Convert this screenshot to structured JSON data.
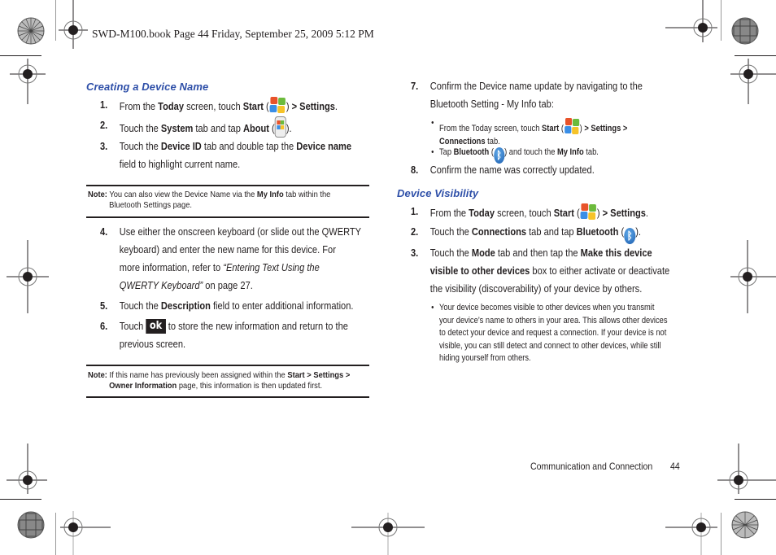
{
  "header": {
    "print_line": "SWD-M100.book  Page 44  Friday, September 25, 2009  5:12 PM"
  },
  "icons": {
    "start": "windows-start-icon",
    "about": "about-device-icon",
    "bluetooth": "bluetooth-icon",
    "ok": "ok"
  },
  "left_column": {
    "section_title": "Creating a Device Name",
    "steps": [
      {
        "num": "1.",
        "parts": [
          "From the ",
          "Today",
          " screen, touch ",
          "Start",
          " (",
          ") ",
          "> Settings",
          "."
        ]
      },
      {
        "num": "2.",
        "parts": [
          "Touch the ",
          "System",
          " tab and tap ",
          "About",
          " (",
          ")."
        ]
      },
      {
        "num": "3.",
        "line1": [
          "Touch the ",
          "Device ID",
          " tab and double tap the ",
          "Device name"
        ],
        "line2": "field to highlight current name."
      },
      {
        "num": "4.",
        "lines": [
          "Use either the onscreen keyboard (or slide out the QWERTY",
          "keyboard) and enter the new name for this device. For",
          "more information, refer to "
        ],
        "link": "“Entering Text Using the",
        "link2": "QWERTY Keyboard”",
        "after_link": "  on page 27."
      },
      {
        "num": "5.",
        "parts": [
          "Touch the ",
          "Description",
          " field to enter additional information."
        ]
      },
      {
        "num": "6.",
        "before": "Touch ",
        "after": " to store the new information and return to the",
        "line2": "previous screen."
      }
    ],
    "note1": {
      "label": "Note:",
      "text1": " You can also view the Device Name via the ",
      "bold": "My Info",
      "text2": " tab within the",
      "line2": "Bluetooth Settings page."
    },
    "note2": {
      "label": "Note:",
      "text1": " If this name has previously been assigned within the ",
      "bold1": "Start > Settings >",
      "bold2": "Owner Information",
      "text2": " page, this information is then updated first."
    }
  },
  "right_column": {
    "step7": {
      "num": "7.",
      "line1": "Confirm the Device name update by navigating to the",
      "line2": "Bluetooth Setting - My Info tab:"
    },
    "bullet1": {
      "t1": "From the Today screen, touch ",
      "b1": "Start",
      "t2": " (",
      "t3": ") ",
      "b2": "> Settings >",
      "b3": "Connections",
      "t4": " tab."
    },
    "bullet2": {
      "t1": "Tap ",
      "b1": "Bluetooth",
      "t2": " (",
      "t3": ") and touch the ",
      "b2": "My Info",
      "t4": " tab."
    },
    "step8": {
      "num": "8.",
      "text": "Confirm the name was correctly updated."
    },
    "section_title": "Device Visibility",
    "vsteps": [
      {
        "num": "1.",
        "parts": [
          "From the ",
          "Today",
          " screen, touch ",
          "Start",
          " (",
          ") ",
          "> Settings",
          "."
        ]
      },
      {
        "num": "2.",
        "parts": [
          "Touch the ",
          "Connections",
          " tab and tap ",
          "Bluetooth",
          " (",
          ")."
        ]
      },
      {
        "num": "3.",
        "l1a": "Touch the ",
        "l1b": "Mode",
        "l1c": " tab and then tap the ",
        "l1d": "Make this device",
        "l2a": "visible to other devices",
        "l2b": " box to either activate or deactivate",
        "l3": "the visibility (discoverability) of your device by others."
      }
    ],
    "vbullet": [
      "Your device becomes visible to other devices when you transmit",
      "your device’s name to others in your area. This allows other devices",
      "to detect your device and request a connection. If your device is not",
      "visible, you can still detect and connect to other devices, while still",
      "hiding yourself from others."
    ]
  },
  "footer": {
    "section": "Communication and Connection",
    "page": "44"
  }
}
